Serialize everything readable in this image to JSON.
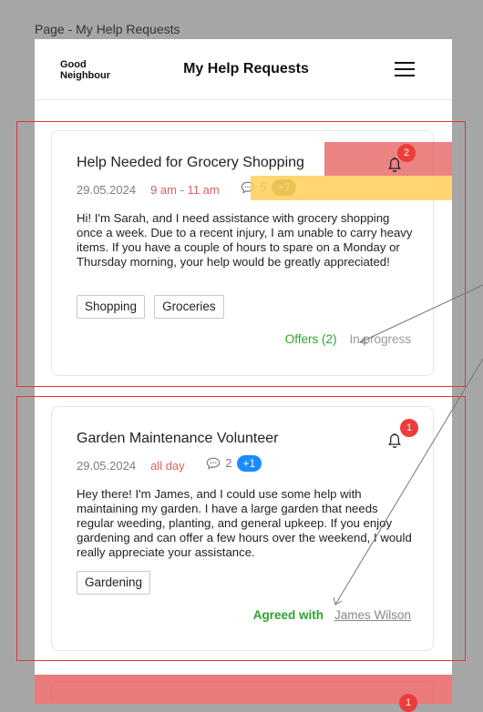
{
  "page_label": "Page - My Help Requests",
  "header": {
    "logo_line1": "Good",
    "logo_line2": "Neighbour",
    "title": "My Help Requests",
    "menu_icon": "hamburger-menu-icon"
  },
  "requests": [
    {
      "title": "Help Needed for Grocery Shopping",
      "date": "29.05.2024",
      "time": "9 am - 11 am",
      "comment_count": "5",
      "comment_extra": "+7",
      "notification_count": "2",
      "description": "Hi! I'm Sarah, and I need assistance with grocery shopping once a week. Due to a recent injury, I am unable to carry heavy items. If you have a couple of hours to spare on a Monday or Thursday morning, your help would be greatly appreciated!",
      "tags": [
        "Shopping",
        "Groceries"
      ],
      "offers_label": "Offers (2)",
      "status": "In progress"
    },
    {
      "title": "Garden Maintenance Volunteer",
      "date": "29.05.2024",
      "time": "all day",
      "comment_count": "2",
      "comment_extra": "+1",
      "notification_count": "1",
      "description": "Hey there! I'm James, and I could use some help with maintaining my garden. I have a large garden that needs regular weeding, planting, and general upkeep. If you enjoy gardening and can offer a few hours over the weekend, I would really appreciate your assistance.",
      "tags": [
        "Gardening"
      ],
      "agreed_label": "Agreed with",
      "agreed_name": "James Wilson"
    },
    {
      "notification_count": "1"
    }
  ],
  "colors": {
    "accent_green": "#2aa52a",
    "time_red": "#e0605f",
    "badge_gray_green": "#7c9a6e",
    "badge_blue": "#1a8cff",
    "notification_red": "#ee3b3b"
  },
  "icons": [
    "bell-icon",
    "comment-icon"
  ]
}
